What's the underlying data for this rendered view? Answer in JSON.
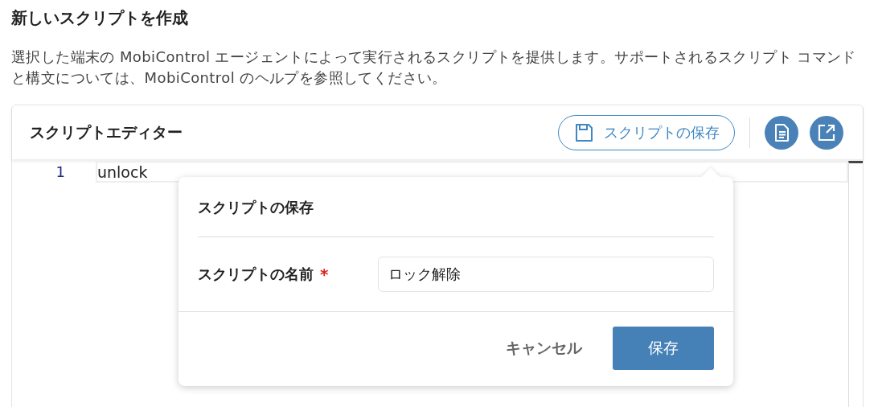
{
  "page": {
    "title": "新しいスクリプトを作成",
    "description": "選択した端末の MobiControl エージェントによって実行されるスクリプトを提供します。サポートされるスクリプト コマンドと構文については、MobiControl のヘルプを参照してください。"
  },
  "editor": {
    "title": "スクリプトエディター",
    "save_button": "スクリプトの保存",
    "lines": [
      {
        "number": "1",
        "code": "unlock"
      }
    ]
  },
  "save_popover": {
    "title": "スクリプトの保存",
    "field_label": "スクリプトの名前",
    "required_mark": "*",
    "value": "ロック解除",
    "cancel": "キャンセル",
    "save": "保存"
  }
}
